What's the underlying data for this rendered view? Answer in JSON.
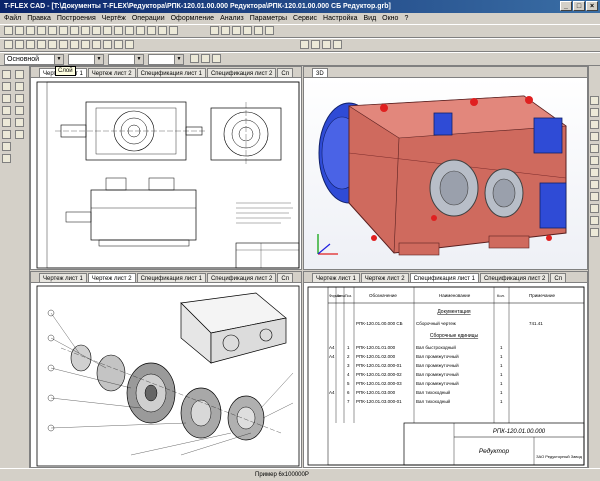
{
  "window": {
    "title": "T-FLEX CAD - [T:\\Документы T-FLEX\\Редуктора\\РПК-120.01.00.000 Редуктора\\РПК-120.01.00.000 СБ Редуктор.grb]",
    "min": "_",
    "max": "□",
    "close": "×"
  },
  "menu": [
    "Файл",
    "Правка",
    "Построения",
    "Чертёж",
    "Операции",
    "Оформление",
    "Анализ",
    "Параметры",
    "Сервис",
    "Настройка",
    "Вид",
    "Окно",
    "?"
  ],
  "toolbar": {
    "layer_value": "Основной",
    "tooltip": "Слой"
  },
  "panes": {
    "top_left_tabs": [
      "Чертеж лист 1",
      "Чертеж лист 2",
      "Спецификация лист 1",
      "Спецификация лист 2",
      "Сп"
    ],
    "top_right_tabs": [
      "3D"
    ],
    "bottom_left_tabs": [
      "Чертеж лист 1",
      "Чертеж лист 2",
      "Спецификация лист 1",
      "Спецификация лист 2",
      "Сп"
    ],
    "bottom_right_tabs": [
      "Чертеж лист 1",
      "Чертеж лист 2",
      "Спецификация лист 1",
      "Спецификация лист 2",
      "Сп"
    ]
  },
  "spec": {
    "headers": [
      "Формат",
      "Зона",
      "Поз.",
      "Обозначение",
      "Наименование",
      "Кол.",
      "Примечание"
    ],
    "rows": [
      [
        "",
        "",
        "",
        "",
        "Документация",
        "",
        ""
      ],
      [
        "",
        "",
        "",
        "РПК-120.01.00.000 СБ",
        "Сборочный чертеж",
        "",
        "741.41"
      ],
      [
        "",
        "",
        "",
        "",
        "Сборочные единицы",
        "",
        ""
      ],
      [
        "A4",
        "",
        "1",
        "РПК-120.01.01.000",
        "Вал быстроходный",
        "1",
        ""
      ],
      [
        "A4",
        "",
        "2",
        "РПК-120.01.02.000",
        "Вал промежуточный",
        "1",
        ""
      ],
      [
        "",
        "",
        "3",
        "РПК-120.01.02.000-01",
        "Вал промежуточный",
        "1",
        ""
      ],
      [
        "",
        "",
        "4",
        "РПК-120.01.02.000-02",
        "Вал промежуточный",
        "1",
        ""
      ],
      [
        "",
        "",
        "5",
        "РПК-120.01.02.000-03",
        "Вал промежуточный",
        "1",
        ""
      ],
      [
        "A4",
        "",
        "6",
        "РПК-120.01.03.000",
        "Вал тихоходный",
        "1",
        ""
      ],
      [
        "",
        "",
        "7",
        "РПК-120.01.03.000-01",
        "Вал тихоходный",
        "1",
        ""
      ]
    ],
    "title_code": "РПК-120.01.00.000",
    "title_name": "Редуктор",
    "title_note": "ЗАО Редукторный Завод"
  },
  "status": {
    "text": "Пример 6x100000Р"
  },
  "colors": {
    "titlebar": "#0a246a",
    "housing": "#cf6a5e",
    "cover_blue": "#2f4bd6",
    "accent_red": "#e02020"
  }
}
